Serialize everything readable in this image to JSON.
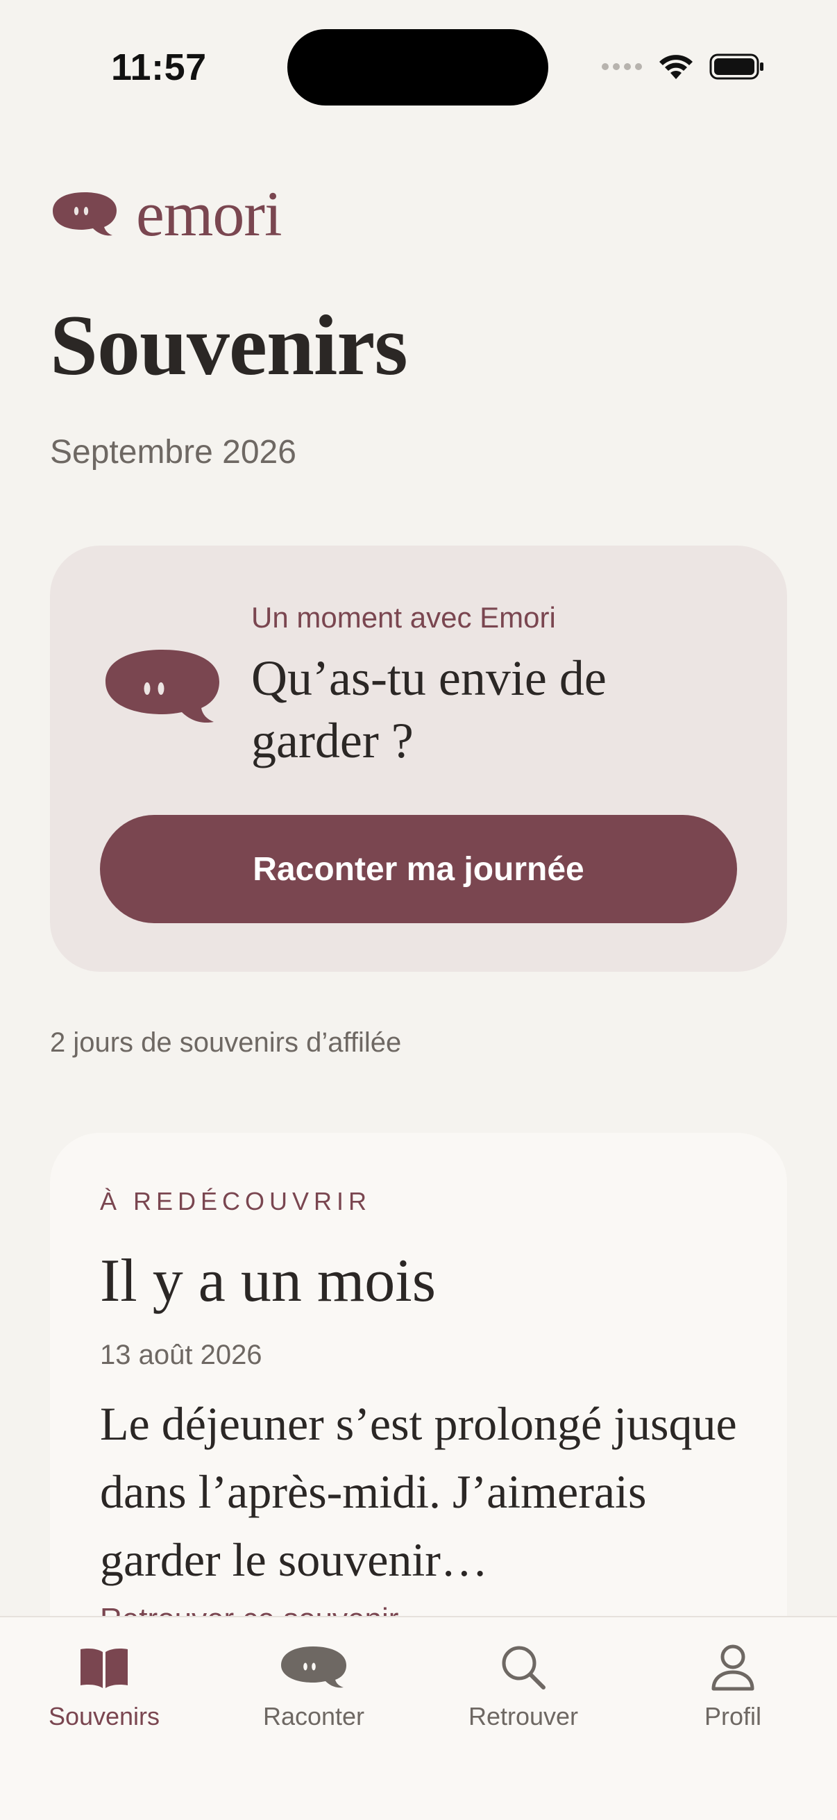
{
  "status_bar": {
    "time": "11:57"
  },
  "brand": {
    "name": "emori",
    "logo_icon": "speech-bubble-face-icon",
    "color": "#7a4650"
  },
  "header": {
    "title": "Souvenirs",
    "subtitle": "Septembre 2026"
  },
  "prompt_card": {
    "eyebrow": "Un moment avec Emori",
    "question": "Qu’as-tu envie de garder ?",
    "button_label": "Raconter ma journée"
  },
  "streak": {
    "text": "2 jours de souvenirs d’affilée"
  },
  "memory_card": {
    "eyebrow": "À REDÉCOUVRIR",
    "title": "Il y a un mois",
    "date": "13 août 2026",
    "excerpt": "Le déjeuner s’est prolongé jusque dans l’après-midi. J’aimerais garder le souvenir…",
    "link_label": "Retrouver ce souvenir →"
  },
  "tab_bar": {
    "tabs": [
      {
        "label": "Souvenirs",
        "icon": "book-icon",
        "active": true
      },
      {
        "label": "Raconter",
        "icon": "speech-bubble-icon",
        "active": false
      },
      {
        "label": "Retrouver",
        "icon": "search-icon",
        "active": false
      },
      {
        "label": "Profil",
        "icon": "person-icon",
        "active": false
      }
    ]
  },
  "colors": {
    "background": "#f5f3ef",
    "accent": "#7a4650",
    "card": "#ece5e3",
    "muted_text": "#6e6863"
  }
}
